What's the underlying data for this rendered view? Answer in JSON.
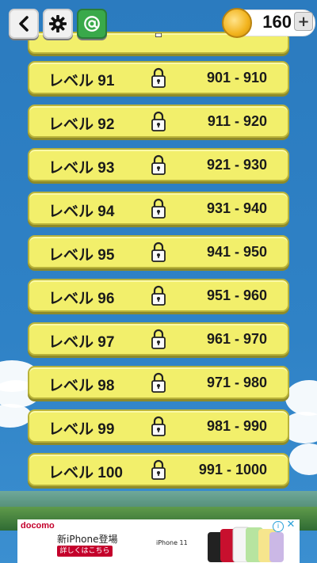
{
  "header": {
    "back_icon": "chevron-left-icon",
    "settings_icon": "gear-icon",
    "share_icon": "at-icon",
    "coins": "160",
    "add_label": "+"
  },
  "levels": [
    {
      "name": "レベル 91",
      "range": "901 - 910",
      "locked": true
    },
    {
      "name": "レベル 92",
      "range": "911 - 920",
      "locked": true
    },
    {
      "name": "レベル 93",
      "range": "921 - 930",
      "locked": true
    },
    {
      "name": "レベル 94",
      "range": "931 - 940",
      "locked": true
    },
    {
      "name": "レベル 95",
      "range": "941 - 950",
      "locked": true
    },
    {
      "name": "レベル 96",
      "range": "951 - 960",
      "locked": true
    },
    {
      "name": "レベル 97",
      "range": "961 - 970",
      "locked": true
    },
    {
      "name": "レベル 98",
      "range": "971 - 980",
      "locked": true
    },
    {
      "name": "レベル 99",
      "range": "981 - 990",
      "locked": true
    },
    {
      "name": "レベル 100",
      "range": "991 - 1000",
      "locked": true
    }
  ],
  "ad": {
    "brand": "docomo",
    "headline": "新iPhone登場",
    "cta": "詳しくはこちら",
    "product": "iPhone 11",
    "info_icon": "info-icon",
    "close_icon": "close-icon"
  },
  "colors": {
    "sky": "#2b7bbf",
    "level_button": "#f2ef6b",
    "level_border": "#b9b33a",
    "coin": "#f2b31d",
    "at_button": "#39a94a"
  }
}
